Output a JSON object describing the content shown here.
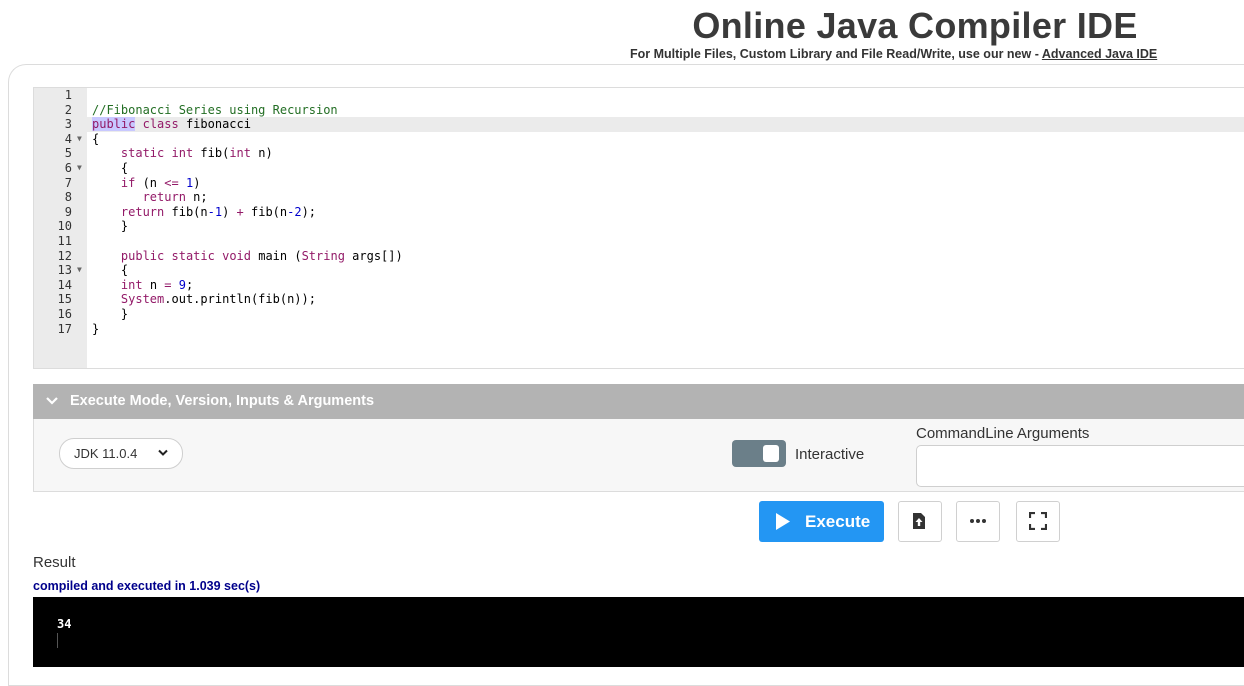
{
  "header": {
    "title": "Online Java Compiler IDE",
    "subtitle_prefix": "For Multiple Files, Custom Library and File Read/Write, use our new - ",
    "subtitle_link": "Advanced Java IDE"
  },
  "editor": {
    "line_numbers": [
      "1",
      "2",
      "3",
      "4",
      "5",
      "6",
      "7",
      "8",
      "9",
      "10",
      "11",
      "12",
      "13",
      "14",
      "15",
      "16",
      "17"
    ],
    "code": {
      "l2": "//Fibonacci Series using Recursion",
      "l3_kw1": "public",
      "l3_kw2": "class",
      "l3_rest": " fibonacci",
      "l4": "{",
      "l5_kw1": "static",
      "l5_kw2": "int",
      "l5_mid": " fib(",
      "l5_kw3": "int",
      "l5_end": " n)",
      "l6": "{",
      "l7_kw": "if",
      "l7_a": " (n ",
      "l7_op": "<=",
      "l7_sp": " ",
      "l7_num": "1",
      "l7_end": ")",
      "l8_kw": "return",
      "l8_end": " n;",
      "l9_kw": "return",
      "l9_a": " fib(n",
      "l9_num1": "-1",
      "l9_b": ") ",
      "l9_op": "+",
      "l9_c": " fib(n",
      "l9_num2": "-2",
      "l9_end": ");",
      "l10": "}",
      "l12_kw1": "public",
      "l12_kw2": "static",
      "l12_kw3": "void",
      "l12_mid": " main (",
      "l12_kw4": "String",
      "l12_end": " args[])",
      "l13": "{",
      "l14_kw": "int",
      "l14_a": " n ",
      "l14_op": "=",
      "l14_sp": " ",
      "l14_num": "9",
      "l14_end": ";",
      "l15_kw": "System",
      "l15_end": ".out.println(fib(n));",
      "l16": "}",
      "l17": "}"
    }
  },
  "execute_mode": {
    "bar_label": "Execute Mode, Version, Inputs & Arguments",
    "jdk_selected": "JDK 11.0.4",
    "interactive_label": "Interactive",
    "interactive_on": true,
    "cmdline_label": "CommandLine Arguments",
    "cmdline_value": ""
  },
  "actions": {
    "execute_label": "Execute"
  },
  "result": {
    "label": "Result",
    "status": "compiled and executed in 1.039 sec(s)",
    "output": "34"
  },
  "colors": {
    "keyword": "#931a68",
    "comment": "#236e24",
    "number": "#0000cd",
    "execute_button": "#2396f3",
    "status_text": "#00008b"
  }
}
